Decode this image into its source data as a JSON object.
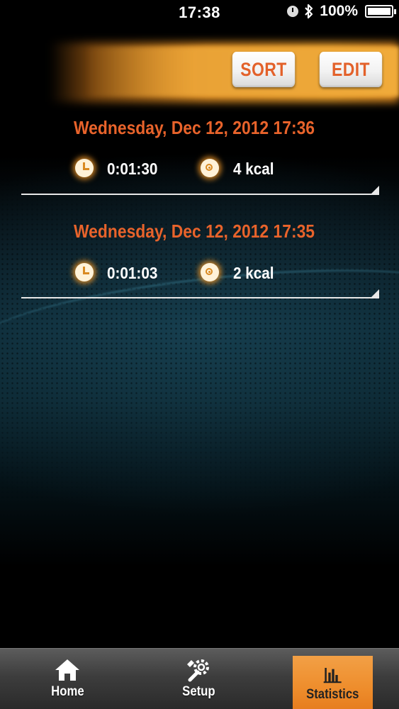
{
  "status_bar": {
    "time": "17:38",
    "battery": "100%",
    "icons": [
      "alarm-icon",
      "bluetooth-icon",
      "battery-icon"
    ]
  },
  "toolbar": {
    "sort_label": "SORT",
    "edit_label": "EDIT"
  },
  "records": [
    {
      "date": "Wednesday, Dec 12, 2012 17:36",
      "duration": "0:01:30",
      "calories": "4 kcal"
    },
    {
      "date": "Wednesday, Dec 12, 2012 17:35",
      "duration": "0:01:03",
      "calories": "2 kcal"
    }
  ],
  "nav": {
    "home_label": "Home",
    "setup_label": "Setup",
    "statistics_label": "Statistics",
    "active": "Statistics"
  },
  "colors": {
    "accent_orange": "#e8632b",
    "header_glow": "#e69a28",
    "active_tab": "#ee8d2c"
  }
}
